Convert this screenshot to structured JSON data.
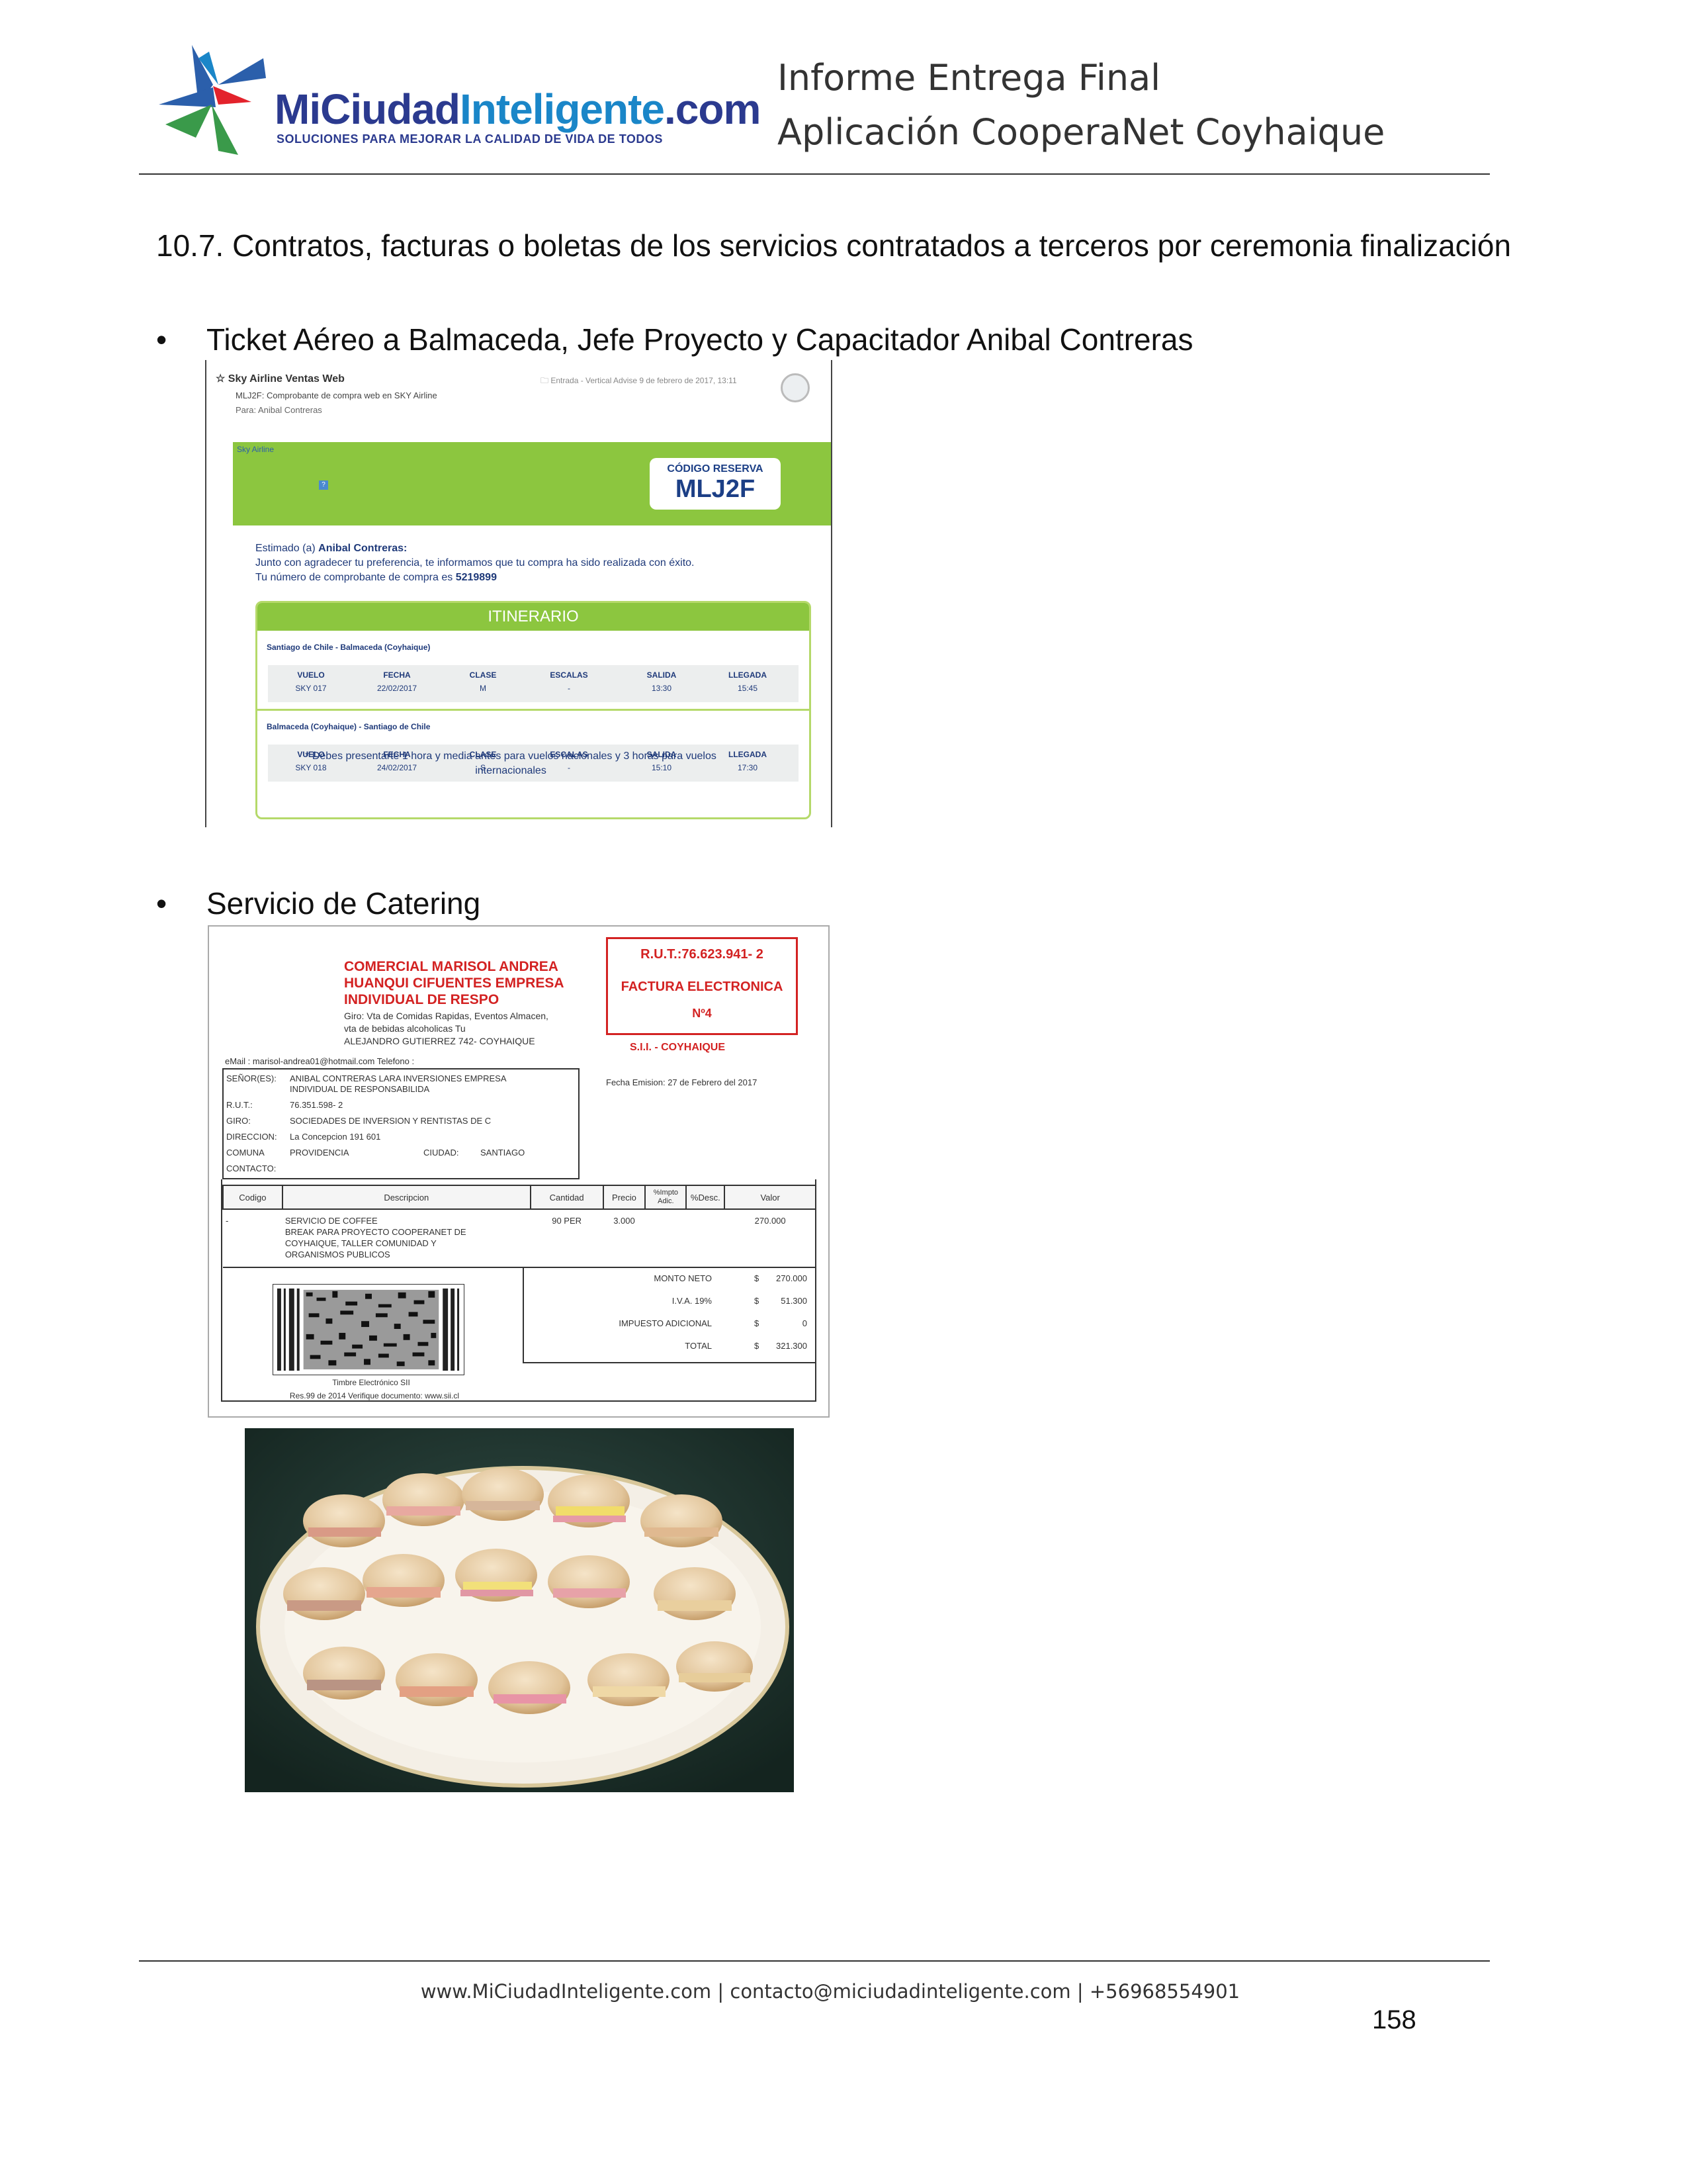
{
  "header": {
    "logo": {
      "word_part1": "MiCiudad",
      "word_part2": "Inteligente",
      "word_part3": ".com",
      "tagline": "SOLUCIONES PARA MEJORAR LA CALIDAD DE VIDA DE TODOS"
    },
    "title_line1": "Informe Entrega Final",
    "title_line2": "Aplicación CooperaNet Coyhaique"
  },
  "section": {
    "heading": "10.7. Contratos, facturas o boletas de los servicios contratados a terceros por ceremonia finalización"
  },
  "bullets": [
    {
      "symbol": "•",
      "text": "Ticket Aéreo a Balmaceda, Jefe Proyecto y Capacitador Anibal Contreras"
    },
    {
      "symbol": "•",
      "text": "Servicio de Catering"
    }
  ],
  "ticket": {
    "from": "☆  Sky Airline Ventas Web",
    "subject": "MLJ2F: Comprobante de compra web en SKY Airline",
    "to": "Para:  Anibal Contreras",
    "date": "🗀 Entrada - Vertical Advise     9 de febrero de 2017, 13:11",
    "brand_small": "Sky Airline",
    "code_label": "CÓDIGO RESERVA",
    "code_value": "MLJ2F",
    "greeting_prefix": "Estimado (a) ",
    "greeting_name": "Anibal Contreras:",
    "line1": "Junto con agradecer tu preferencia, te informamos que tu compra ha sido realizada con éxito.",
    "line2_prefix": "Tu número de comprobante de compra es ",
    "line2_number": "5219899",
    "itinerary_title": "ITINERARIO",
    "legs": [
      {
        "route": "Santiago de Chile - Balmaceda (Coyhaique)",
        "headers": [
          "VUELO",
          "FECHA",
          "CLASE",
          "ESCALAS",
          "SALIDA",
          "LLEGADA"
        ],
        "values": [
          "SKY 017",
          "22/02/2017",
          "M",
          "-",
          "13:30",
          "15:45"
        ]
      },
      {
        "route": "Balmaceda (Coyhaique) - Santiago de Chile",
        "headers": [
          "VUELO",
          "FECHA",
          "CLASE",
          "ESCALAS",
          "SALIDA",
          "LLEGADA"
        ],
        "values": [
          "SKY 018",
          "24/02/2017",
          "S",
          "-",
          "15:10",
          "17:30"
        ]
      }
    ],
    "note_line1": "* Debes presentarte 1 hora y media antes para vuelos nacionales y 3 horas para vuelos",
    "note_line2": "internacionales"
  },
  "invoice": {
    "company_line1": "COMERCIAL MARISOL ANDREA",
    "company_line2": "HUANQUI CIFUENTES EMPRESA",
    "company_line3": "INDIVIDUAL DE RESPO",
    "giro_line1": "Giro: Vta de Comidas Rapidas, Eventos Almacen,",
    "giro_line2": "vta de bebidas alcoholicas Tu",
    "address": "ALEJANDRO GUTIERREZ 742- COYHAIQUE",
    "rut_header": "R.U.T.:76.623.941- 2",
    "doc_type": "FACTURA ELECTRONICA",
    "doc_number": "Nº4",
    "sii": "S.I.I. - COYHAIQUE",
    "email": "eMail : marisol-andrea01@hotmail.com Telefono :",
    "client": {
      "senores_label": "SEÑOR(ES):",
      "senores_value1": "ANIBAL CONTRERAS LARA INVERSIONES EMPRESA",
      "senores_value2": "INDIVIDUAL DE RESPONSABILIDA",
      "rut_label": "R.U.T.:",
      "rut_value": "76.351.598- 2",
      "giro_label": "GIRO:",
      "giro_value": "SOCIEDADES DE INVERSION Y RENTISTAS DE C",
      "dir_label": "DIRECCION:",
      "dir_value": "La Concepcion 191 601",
      "comuna_label": "COMUNA",
      "comuna_value": "PROVIDENCIA",
      "ciudad_label": "CIUDAD:",
      "ciudad_value": "SANTIAGO",
      "contacto_label": "CONTACTO:"
    },
    "fecha_emision": "Fecha Emision:  27 de Febrero del 2017",
    "table_headers": [
      "Codigo",
      "Descripcion",
      "Cantidad",
      "Precio",
      "%Impto Adic.",
      "%Desc.",
      "Valor"
    ],
    "item": {
      "codigo": "-",
      "desc1": "SERVICIO DE COFFEE",
      "desc2": "BREAK PARA PROYECTO COOPERANET DE",
      "desc3": "COYHAIQUE, TALLER COMUNIDAD Y",
      "desc4": "ORGANISMOS PUBLICOS",
      "cantidad": "90  PER",
      "precio": "3.000",
      "valor": "270.000"
    },
    "totals": [
      {
        "label": "MONTO NETO",
        "currency": "$",
        "value": "270.000"
      },
      {
        "label": "I.V.A. 19%",
        "currency": "$",
        "value": "51.300"
      },
      {
        "label": "IMPUESTO ADICIONAL",
        "currency": "$",
        "value": "0"
      },
      {
        "label": "TOTAL",
        "currency": "$",
        "value": "321.300"
      }
    ],
    "timbre": "Timbre Electrónico SII",
    "resolucion": "Res.99 de 2014 Verifique documento: www.sii.cl"
  },
  "footer": {
    "text": "www.MiCiudadInteligente.com | contacto@miciudadinteligente.com | +56968554901",
    "page_number": "158"
  }
}
